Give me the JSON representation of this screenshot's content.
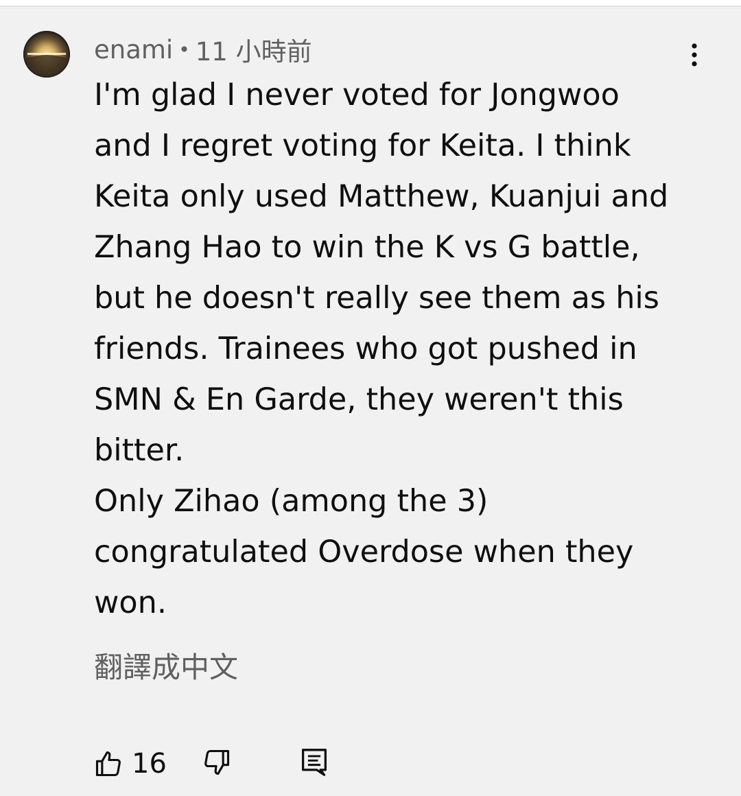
{
  "comment": {
    "author": "enami",
    "separator": "•",
    "timestamp": "11 小時前",
    "body_lines": [
      "I'm glad I never voted for Jongwoo",
      "and I regret voting for Keita. I think",
      "Keita only used Matthew, Kuanjui and",
      "Zhang Hao to win the K vs G battle,",
      "but he doesn't really see them as his",
      "friends. Trainees who got pushed in",
      "SMN & En Garde, they weren't this",
      "bitter.",
      "Only Zihao (among the 3)",
      "congratulated Overdose when they",
      "won."
    ],
    "translate_label": "翻譯成中文",
    "like_count": "16",
    "icons": {
      "more": "more-vert-icon",
      "like": "thumb-up-icon",
      "dislike": "thumb-down-icon",
      "reply": "reply-comment-icon"
    }
  },
  "colors": {
    "background": "#f1f1f1",
    "text_primary": "#0f0f0f",
    "text_secondary": "#606060"
  }
}
